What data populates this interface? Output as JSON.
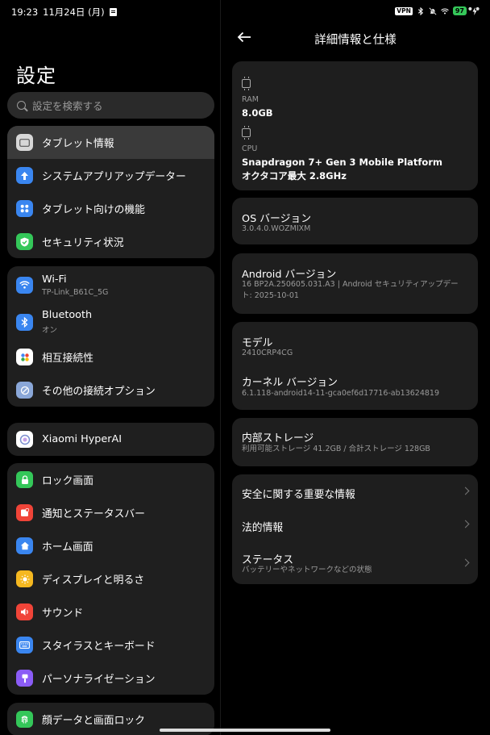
{
  "status_bar": {
    "time": "19:23",
    "date": "11月24日 (月)",
    "vpn": "VPN",
    "battery": "97"
  },
  "settings": {
    "title": "設定",
    "search_placeholder": "設定を検索する",
    "group1": [
      {
        "label": "タブレット情報",
        "icon": "tablet-icon",
        "color": "#d7d7d7",
        "selected": true
      },
      {
        "label": "システムアプリアップデーター",
        "icon": "arrow-up-icon",
        "color": "#3a86f0"
      },
      {
        "label": "タブレット向けの機能",
        "icon": "grid-icon",
        "color": "#3a86f0"
      },
      {
        "label": "セキュリティ状況",
        "icon": "shield-check-icon",
        "color": "#34c759"
      }
    ],
    "group2": [
      {
        "label": "Wi-Fi",
        "sub": "TP-Link_B61C_5G",
        "icon": "wifi-icon",
        "color": "#3a86f0"
      },
      {
        "label": "Bluetooth",
        "sub": "オン",
        "icon": "bluetooth-icon",
        "color": "#3a86f0"
      },
      {
        "label": "相互接続性",
        "icon": "interconnect-icon",
        "color": "#ffffff"
      },
      {
        "label": "その他の接続オプション",
        "icon": "link-icon",
        "color": "#8aa7d8"
      }
    ],
    "group3": [
      {
        "label": "Xiaomi HyperAI",
        "icon": "hyperai-icon",
        "color": "#ffffff"
      }
    ],
    "group4": [
      {
        "label": "ロック画面",
        "icon": "lock-icon",
        "color": "#34c759"
      },
      {
        "label": "通知とステータスバー",
        "icon": "notification-icon",
        "color": "#f04438"
      },
      {
        "label": "ホーム画面",
        "icon": "home-icon",
        "color": "#3a86f0"
      },
      {
        "label": "ディスプレイと明るさ",
        "icon": "sun-icon",
        "color": "#f5b820"
      },
      {
        "label": "サウンド",
        "icon": "speaker-icon",
        "color": "#f04438"
      },
      {
        "label": "スタイラスとキーボード",
        "icon": "keyboard-icon",
        "color": "#3a86f0"
      },
      {
        "label": "パーソナライゼーション",
        "icon": "brush-icon",
        "color": "#8b5cf6"
      }
    ],
    "group5": [
      {
        "label": "顔データと画面ロック",
        "icon": "fingerprint-icon",
        "color": "#34c759"
      }
    ]
  },
  "detail": {
    "title": "詳細情報と仕様",
    "ram_label": "RAM",
    "ram_value": "8.0GB",
    "cpu_label": "CPU",
    "cpu_value1": "Snapdragon 7+ Gen 3 Mobile Platform",
    "cpu_value2": "オクタコア最大 2.8GHz",
    "os_label": "OS バージョン",
    "os_value": "3.0.4.0.WOZMIXM",
    "android_label": "Android バージョン",
    "android_value1": "16 BP2A.250605.031.A3 | Android セキュリティアップデー",
    "android_value2": "ト: 2025-10-01",
    "model_label": "モデル",
    "model_value": "2410CRP4CG",
    "kernel_label": "カーネル バージョン",
    "kernel_value": "6.1.118-android14-11-gca0ef6d17716-ab13624819",
    "storage_label": "内部ストレージ",
    "storage_value": "利用可能ストレージ  41.2GB / 合計ストレージ  128GB",
    "safety_label": "安全に関する重要な情報",
    "legal_label": "法的情報",
    "status_label": "ステータス",
    "status_sub": "バッテリーやネットワークなどの状態"
  }
}
